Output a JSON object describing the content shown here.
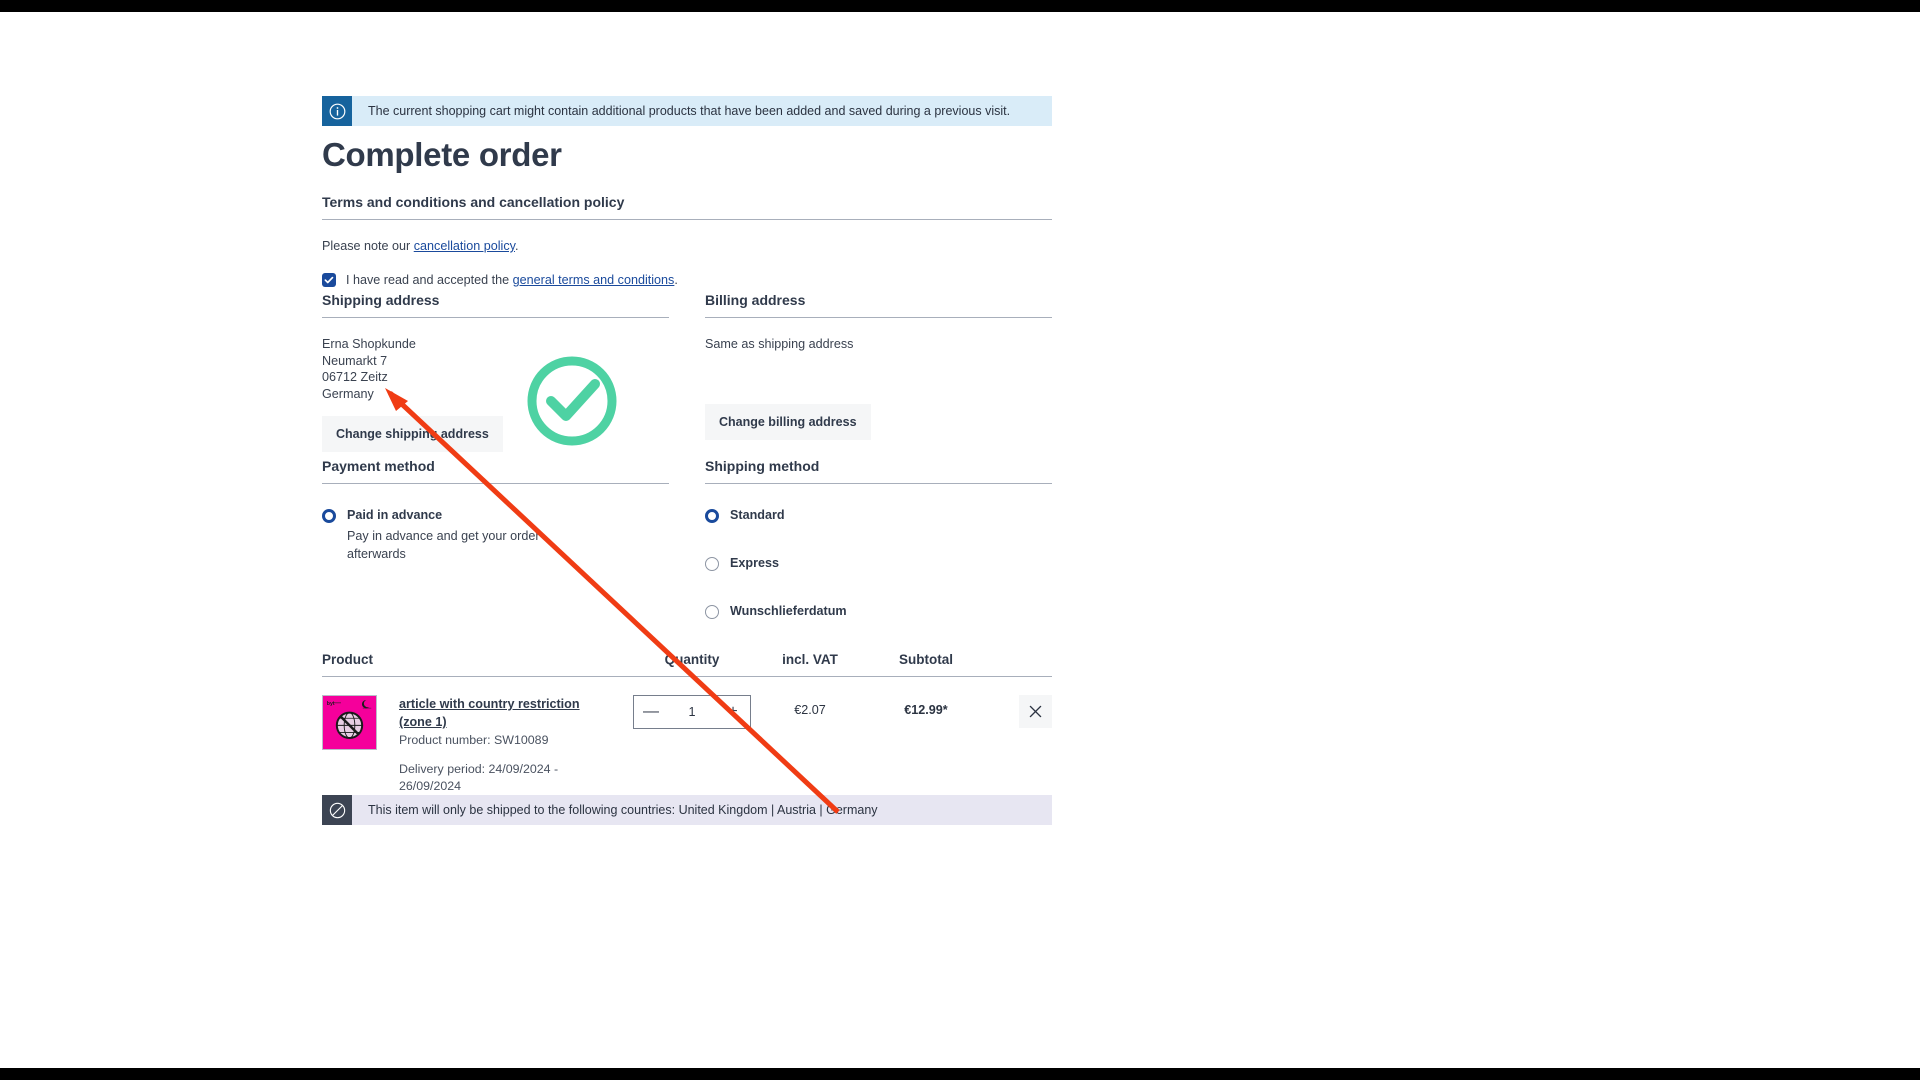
{
  "banner": {
    "icon": "info-circle-icon",
    "text": "The current shopping cart might contain additional products that have been added and saved during a previous visit.",
    "icon_bg": "#16639d",
    "body_bg": "#d9ecf8"
  },
  "page_title": "Complete order",
  "terms": {
    "heading": "Terms and conditions and cancellation policy",
    "note_prefix": "Please note our ",
    "note_link": "cancellation policy",
    "note_suffix": ".",
    "checkbox_checked": true,
    "checkbox_prefix": "I have read and accepted the ",
    "checkbox_link": "general terms and conditions",
    "checkbox_suffix": "."
  },
  "shipping_address": {
    "heading": "Shipping address",
    "lines": [
      "Erna Shopkunde",
      "Neumarkt 7",
      "06712 Zeitz",
      "Germany"
    ],
    "button": "Change shipping address"
  },
  "billing_address": {
    "heading": "Billing address",
    "text": "Same as shipping address",
    "button": "Change billing address"
  },
  "payment_method": {
    "heading": "Payment method",
    "options": [
      {
        "label": "Paid in advance",
        "description": "Pay in advance and get your order afterwards",
        "selected": true
      }
    ]
  },
  "shipping_method": {
    "heading": "Shipping method",
    "options": [
      {
        "label": "Standard",
        "selected": true
      },
      {
        "label": "Express",
        "selected": false
      },
      {
        "label": "Wunschlieferdatum",
        "selected": false
      }
    ]
  },
  "product_table": {
    "columns": [
      "Product",
      "Quantity",
      "incl. VAT",
      "Subtotal"
    ],
    "rows": [
      {
        "name": "article with country restriction (zone 1)",
        "product_number": "Product number: SW10089",
        "delivery_period": "Delivery period: 24/09/2024 - 26/09/2024",
        "quantity": "1",
        "decrease_label": "—",
        "increase_label": "+",
        "vat": "€2.07",
        "subtotal": "€12.99*",
        "remove_label": "✕",
        "thumb_bg": "#f5009b",
        "thumb_brand": "byte",
        "thumb_brand2": "shopware"
      }
    ]
  },
  "notice": {
    "icon": "no-entry-icon",
    "text": "This item will only be shipped to the following countries: United Kingdom | Austria | Germany",
    "icon_bg": "#3c4453",
    "body_bg": "#e7e6f2"
  },
  "annotations": {
    "check_color": "#4ed2a3",
    "arrow_color": "#f03c14"
  }
}
